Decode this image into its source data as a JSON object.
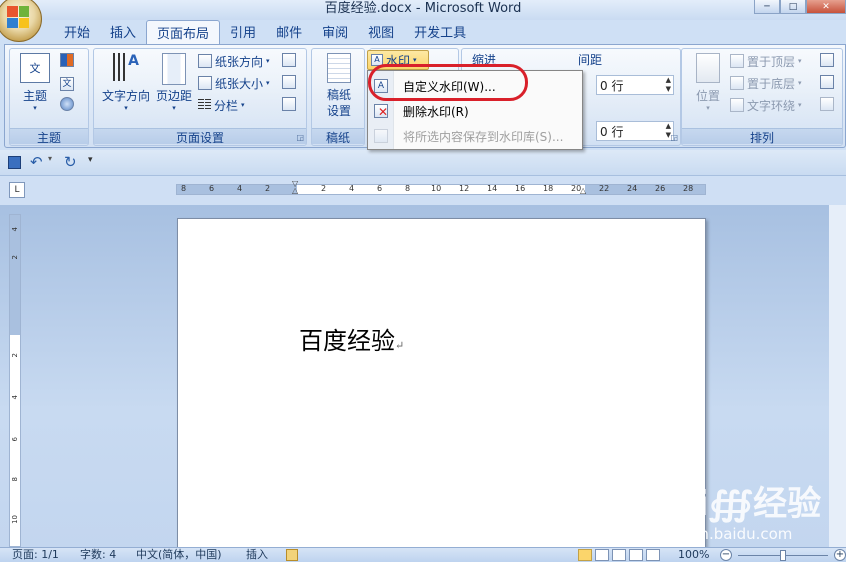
{
  "window": {
    "title": "百度经验.docx - Microsoft Word",
    "minimize": "─",
    "maximize": "□",
    "close": "✕"
  },
  "tabs": [
    "开始",
    "插入",
    "页面布局",
    "引用",
    "邮件",
    "审阅",
    "视图",
    "开发工具"
  ],
  "active_tab": "页面布局",
  "ribbon": {
    "theme_group": {
      "label": "主题",
      "themes_button": "主题",
      "colors_icon": "theme-colors-icon",
      "fonts_icon": "theme-fonts-icon",
      "effects_icon": "theme-effects-icon"
    },
    "page_setup_group": {
      "label": "页面设置",
      "text_direction": "文字方向",
      "margins": "页边距",
      "orientation": "纸张方向",
      "size": "纸张大小",
      "columns": "分栏"
    },
    "draft_group": {
      "label": "稿纸",
      "draft_settings_line1": "稿纸",
      "draft_settings_line2": "设置"
    },
    "page_background_group": {
      "watermark_button": "水印"
    },
    "paragraph_group": {
      "indent_label": "缩进",
      "spacing_label": "间距",
      "spacing_before": "0 行",
      "spacing_after": "0 行"
    },
    "arrange_group": {
      "label": "排列",
      "position": "位置",
      "bring_to_front": "置于顶层",
      "send_to_back": "置于底层",
      "text_wrapping": "文字环绕"
    }
  },
  "watermark_menu": {
    "items": [
      {
        "label": "自定义水印(W)...",
        "enabled": true,
        "icon": "custom-watermark-icon"
      },
      {
        "label": "删除水印(R)",
        "enabled": true,
        "icon": "remove-watermark-icon"
      },
      {
        "label": "将所选内容保存到水印库(S)...",
        "enabled": false,
        "icon": "save-watermark-icon"
      }
    ],
    "highlight_color": "#d9202a"
  },
  "qat": {
    "save_icon": "save-icon",
    "undo_icon": "undo-icon",
    "redo_icon": "redo-icon",
    "customize_icon": "customize-qat-icon"
  },
  "ruler": {
    "horizontal_ticks": [
      "8",
      "6",
      "4",
      "2",
      "2",
      "4",
      "6",
      "8",
      "10",
      "12",
      "14",
      "16",
      "18",
      "20",
      "22",
      "24",
      "26",
      "28"
    ],
    "vertical_ticks": [
      "4",
      "2",
      "2",
      "4",
      "6",
      "8",
      "10"
    ],
    "corner": "L"
  },
  "document": {
    "text": "百度经验",
    "paragraph_mark": "↵"
  },
  "status_bar": {
    "page": "页面: 1/1",
    "word_count": "字数: 4",
    "language": "中文(简体，中国)",
    "insert_mode": "插入",
    "zoom": "100%"
  },
  "watermark_overlay": {
    "logo": "Bai∰经验",
    "url": "jingyan.baidu.com"
  },
  "colors": {
    "ribbon_text": "#15428b",
    "accent_orange": "#fbd56b",
    "page_bg": "#ffffff"
  }
}
